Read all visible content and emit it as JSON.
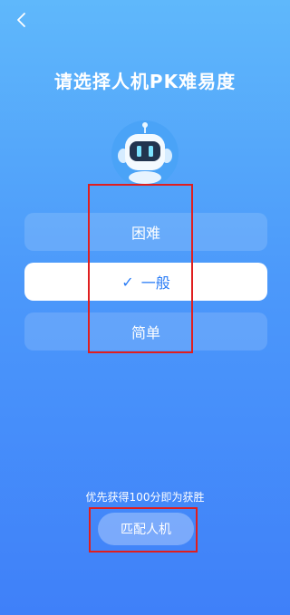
{
  "header": {
    "back_icon": "chevron-left-icon",
    "title": "请选择人机PK难易度"
  },
  "robot": {
    "icon": "robot-avatar-icon"
  },
  "difficulty": {
    "options": [
      {
        "label": "困难",
        "selected": false
      },
      {
        "label": "一般",
        "selected": true
      },
      {
        "label": "简单",
        "selected": false
      }
    ],
    "selected_check": "✓"
  },
  "footer": {
    "hint": "优先获得100分即为获胜",
    "match_label": "匹配人机"
  },
  "colors": {
    "bg_top": "#5fb8fb",
    "bg_bottom": "#3f80f9",
    "selected_text": "#2a7cf6",
    "highlight_box": "#e01e1e"
  }
}
